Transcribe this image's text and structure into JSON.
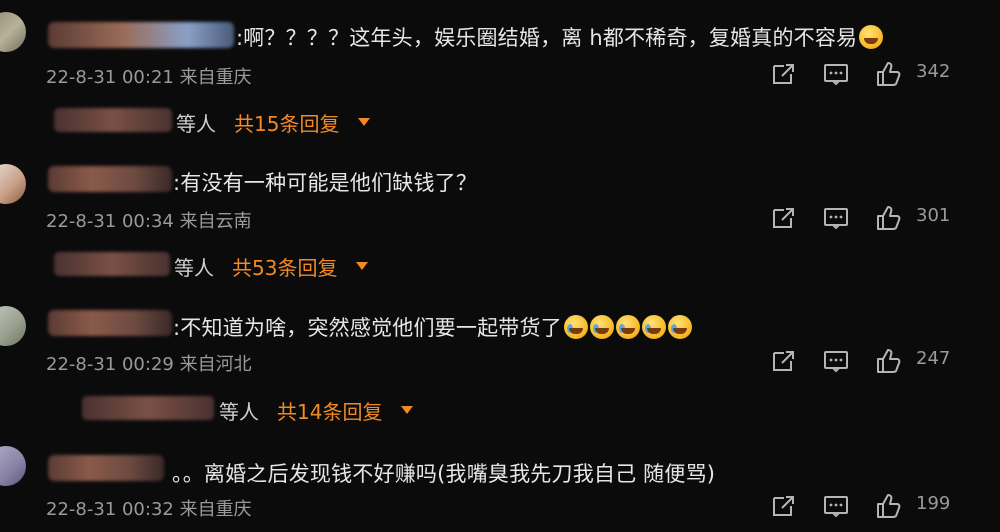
{
  "comments": [
    {
      "text": ":啊？？？？这年头，娱乐圈结婚，离  h都不稀奇，复婚真的不容易",
      "emoji": "grinning-sweat-emoji",
      "date": "22-8-31 00:21",
      "location": "来自重庆",
      "likes": "342",
      "people_label": "等人",
      "reply_total": "共15条回复"
    },
    {
      "text": ":有没有一种可能是他们缺钱了？",
      "date": "22-8-31 00:34",
      "location": "来自云南",
      "likes": "301",
      "people_label": "等人",
      "reply_total": "共53条回复"
    },
    {
      "text": ":不知道为啥，突然感觉他们要一起带货了",
      "emoji": "crying-laughing-emoji",
      "emoji_count": 5,
      "date": "22-8-31 00:29",
      "location": "来自河北",
      "likes": "247",
      "people_label": "等人",
      "reply_total": "共14条回复"
    },
    {
      "text": "。。离婚之后发现钱不好赚吗(我嘴臭我先刀我自己 随便骂)",
      "date": "22-8-31 00:32",
      "location": "来自重庆",
      "likes": "199"
    }
  ],
  "colors": {
    "background": "#0b0b0c",
    "reply_accent": "#f08a24",
    "meta_gray": "#9a9a9a",
    "body_text": "#e6e6e6"
  },
  "icons": [
    "share-icon",
    "comment-icon",
    "like-icon",
    "chevron-down-icon"
  ]
}
